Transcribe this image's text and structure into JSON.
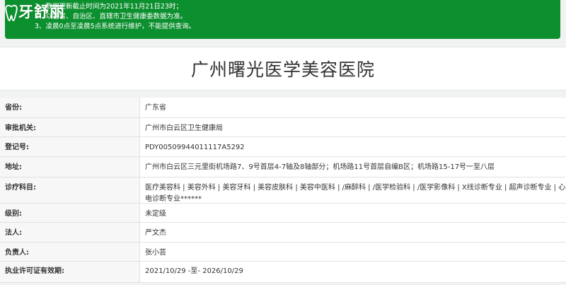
{
  "logo": {
    "text": "牙舒丽"
  },
  "notice": {
    "lines": [
      "1、数据更新截止时间为2021年11月21日23时；",
      "2、以各省、自治区、直辖市卫生健康委数据为准。",
      "3、凌晨0点至凌晨5点系统进行维护，不能提供查询。"
    ]
  },
  "hospital": {
    "name": "广州曙光医学美容医院"
  },
  "fields": [
    {
      "label": "省份:",
      "value": "广东省"
    },
    {
      "label": "审批机关:",
      "value": "广州市白云区卫生健康局"
    },
    {
      "label": "登记号:",
      "value": "PDY00509944011117A5292"
    },
    {
      "label": "地址:",
      "value": "广州市白云区三元里街机场路7、9号首层4-7轴及8轴部分；机场路11号首层自编B区；机场路15-17号一至八层"
    },
    {
      "label": "诊疗科目:",
      "value": "医疗美容科 | 美容外科 | 美容牙科 | 美容皮肤科 | 美容中医科 | /麻醉科 | /医学检验科 | /医学影像科 | X线诊断专业 | 超声诊断专业 | 心电诊断专业******"
    },
    {
      "label": "级别:",
      "value": "未定级"
    },
    {
      "label": "法人:",
      "value": "严文杰"
    },
    {
      "label": "负责人:",
      "value": "张小芸"
    },
    {
      "label": "执业许可证有效期:",
      "value": "2021/10/29 -至- 2026/10/29"
    }
  ],
  "colors": {
    "notice_bg": "#0c8f2e",
    "label_bg": "#f7f7f7"
  }
}
